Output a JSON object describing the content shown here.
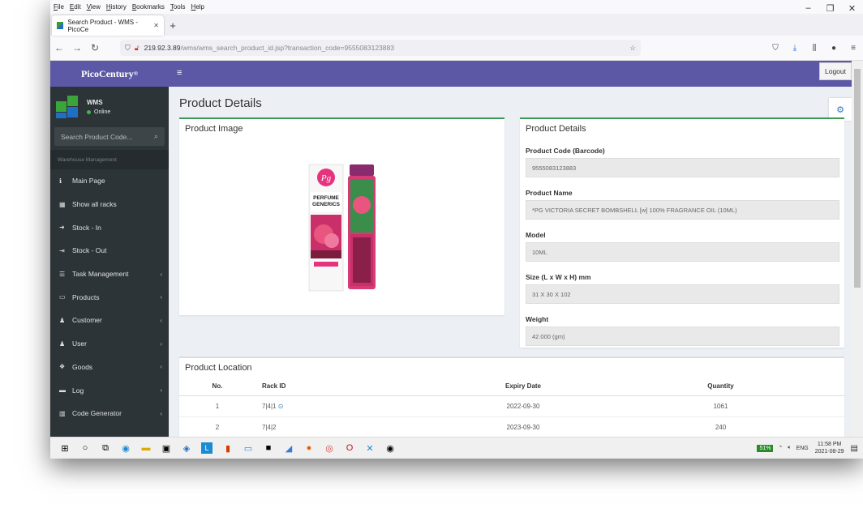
{
  "browser": {
    "menu": [
      "File",
      "Edit",
      "View",
      "History",
      "Bookmarks",
      "Tools",
      "Help"
    ],
    "tab_title": "Search Product - WMS - PicoCe",
    "url_host": "219.92.3.89",
    "url_path": "/wms/wms_search_product_id.jsp?transaction_code=9555083123883"
  },
  "sidebar": {
    "brand": "PicoCentury",
    "user_name": "WMS",
    "user_status": "Online",
    "search_placeholder": "Search Product Code...",
    "section_header": "Warehouse Management",
    "items": [
      {
        "label": "Main Page",
        "icon": "info-icon",
        "chev": ""
      },
      {
        "label": "Show all racks",
        "icon": "table-icon",
        "chev": ""
      },
      {
        "label": "Stock - In",
        "icon": "sign-in-icon",
        "chev": ""
      },
      {
        "label": "Stock - Out",
        "icon": "sign-out-icon",
        "chev": ""
      },
      {
        "label": "Task Management",
        "icon": "tasks-icon",
        "chev": "‹"
      },
      {
        "label": "Products",
        "icon": "laptop-icon",
        "chev": "‹"
      },
      {
        "label": "Customer",
        "icon": "user-icon",
        "chev": "‹"
      },
      {
        "label": "User",
        "icon": "user-icon",
        "chev": "‹"
      },
      {
        "label": "Goods",
        "icon": "cubes-icon",
        "chev": "‹"
      },
      {
        "label": "Log",
        "icon": "list-icon",
        "chev": "‹"
      },
      {
        "label": "Code Generator",
        "icon": "barcode-icon",
        "chev": "‹"
      }
    ]
  },
  "topbar": {
    "logout": "Logout"
  },
  "page": {
    "title": "Product Details"
  },
  "image_box": {
    "title": "Product Image"
  },
  "details": {
    "title": "Product Details",
    "fields": [
      {
        "label": "Product Code (Barcode)",
        "value": "9555083123883"
      },
      {
        "label": "Product Name",
        "value": "*PG VICTORIA SECRET BOMBSHELL [w] 100% FRAGRANCE OIL (10ML)"
      },
      {
        "label": "Model",
        "value": "10ML"
      },
      {
        "label": "Size (L x W x H) mm",
        "value": "31 X 30 X 102"
      },
      {
        "label": "Weight",
        "value": "42.000 (gm)"
      }
    ]
  },
  "location": {
    "title": "Product Location",
    "headers": [
      "No.",
      "Rack ID",
      "Expiry Date",
      "Quantity"
    ],
    "rows": [
      {
        "no": "1",
        "rack": "7|4|1",
        "expiry": "2022-09-30",
        "qty": "1061"
      },
      {
        "no": "2",
        "rack": "7|4|2",
        "expiry": "2023-09-30",
        "qty": "240"
      }
    ]
  },
  "taskbar": {
    "battery": "51%",
    "lang": "ENG",
    "time": "11:58 PM",
    "date": "2021-08-29"
  }
}
